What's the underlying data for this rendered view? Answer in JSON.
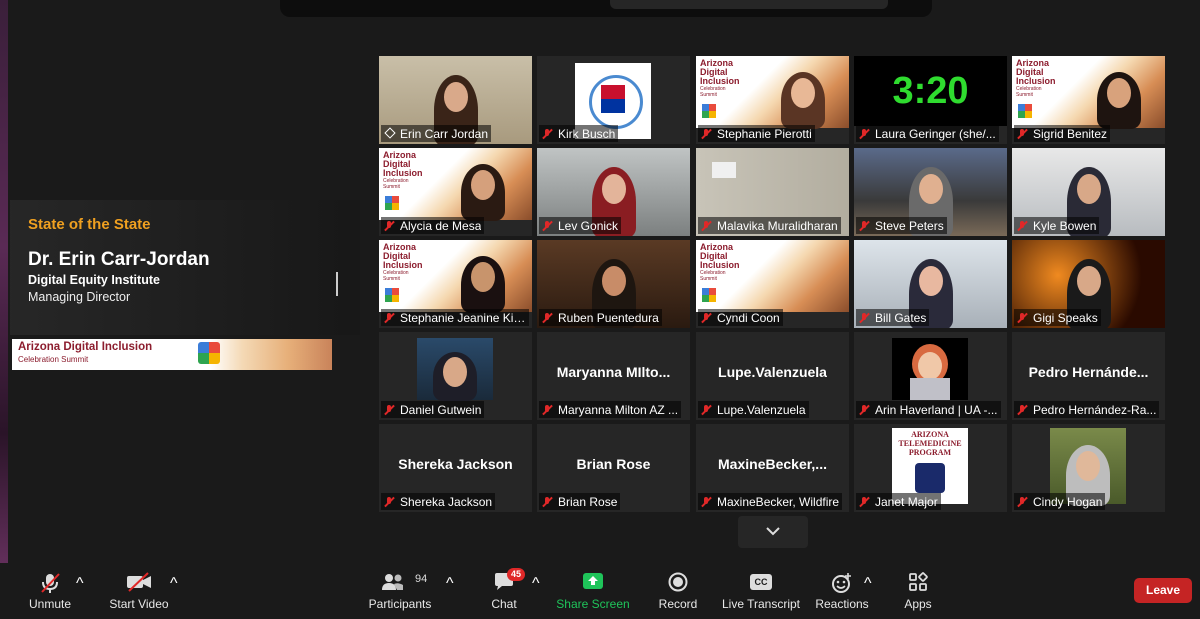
{
  "presenter": {
    "event": "State of the State",
    "name": "Dr. Erin Carr-Jordan",
    "org": "Digital Equity Institute",
    "role": "Managing Director",
    "banner_title": "Arizona Digital Inclusion",
    "banner_sub": "Celebration Summit"
  },
  "tiles": [
    {
      "label": "Erin Carr Jordan",
      "active": true
    },
    {
      "label": "Kirk Busch"
    },
    {
      "label": "Stephanie Pierotti"
    },
    {
      "label": "Laura Geringer (she/..."
    },
    {
      "label": "Sigrid Benitez"
    },
    {
      "label": "Alycia de Mesa"
    },
    {
      "label": "Lev Gonick"
    },
    {
      "label": "Malavika Muralidharan"
    },
    {
      "label": "Steve Peters"
    },
    {
      "label": "Kyle Bowen"
    },
    {
      "label": "Stephanie Jeanine King"
    },
    {
      "label": "Ruben Puentedura"
    },
    {
      "label": "Cyndi Coon"
    },
    {
      "label": "Bill Gates"
    },
    {
      "label": "Gigi Speaks"
    },
    {
      "label": "Daniel Gutwein"
    },
    {
      "label": "Maryanna Milton AZ ...",
      "big": "Maryanna  MIlto..."
    },
    {
      "label": "Lupe.Valenzuela",
      "big": "Lupe.Valenzuela"
    },
    {
      "label": "Arin Haverland | UA -..."
    },
    {
      "label": "Pedro Hernández-Ra...",
      "big": "Pedro  Hernánde..."
    },
    {
      "label": "Shereka Jackson",
      "big": "Shereka Jackson"
    },
    {
      "label": "Brian Rose",
      "big": "Brian Rose"
    },
    {
      "label": "MaxineBecker, Wildfire",
      "big": "MaxineBecker,..."
    },
    {
      "label": "Janet Major"
    },
    {
      "label": "Cindy Hogan"
    }
  ],
  "thumb_text": {
    "timer": "3:20",
    "az1": "Arizona",
    "az2": "Digital",
    "az3": "Inclusion",
    "az_sub1": "Celebration",
    "az_sub2": "Summit",
    "tele1": "ARIZONA",
    "tele2": "TELEMEDICINE",
    "tele3": "PROGRAM"
  },
  "toolbar": {
    "unmute": "Unmute",
    "start_video": "Start Video",
    "participants": "Participants",
    "participants_count": "94",
    "chat": "Chat",
    "chat_badge": "45",
    "share_screen": "Share Screen",
    "record": "Record",
    "live_transcript": "Live Transcript",
    "cc": "CC",
    "reactions": "Reactions",
    "apps": "Apps",
    "leave": "Leave"
  },
  "colors": {
    "accent_active": "#c7e43a",
    "share_green": "#1fc45a",
    "leave_red": "#c52424",
    "muted_red": "#e02828"
  }
}
